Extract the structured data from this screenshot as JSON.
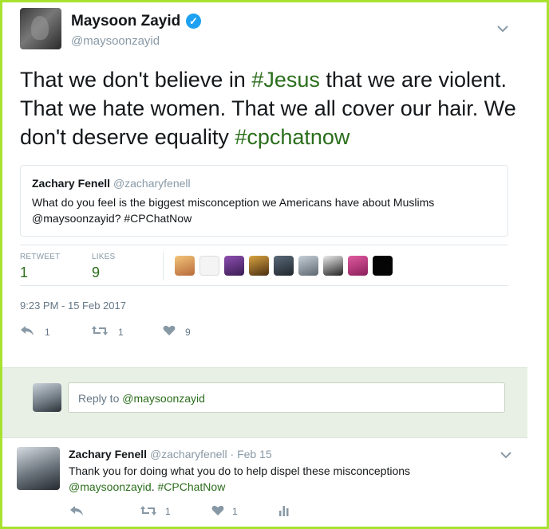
{
  "tweet": {
    "author_name": "Maysoon Zayid",
    "author_handle": "@maysoonzayid",
    "verified_glyph": "✓",
    "text_parts": [
      "That we don't believe in ",
      "#Jesus",
      " that we are violent. That we hate women.  That we all cover our hair. We don't deserve equality ",
      "#cpchatnow"
    ],
    "quoted": {
      "name": "Zachary Fenell",
      "handle": "@zacharyfenell",
      "text": "What do you feel is the biggest misconception we Americans have about Muslims @maysoonzayid? #CPChatNow"
    },
    "stats": {
      "retweets_label": "RETWEET",
      "retweets": "1",
      "likes_label": "LIKES",
      "likes": "9"
    },
    "timestamp": "9:23 PM - 15 Feb 2017",
    "actions": {
      "reply_count": "1",
      "retweet_count": "1",
      "like_count": "9"
    }
  },
  "reply_box": {
    "prefix": "Reply to ",
    "mention": "@maysoonzayid"
  },
  "reply_tweet": {
    "name": "Zachary Fenell",
    "handle": "@zacharyfenell",
    "separator": " · ",
    "date": "Feb 15",
    "text_line1": "Thank you for doing what you do to help dispel these misconceptions",
    "mention": "@maysoonzayid",
    "sep": ". ",
    "hashtag": "#CPChatNow",
    "retweet_count": "1",
    "like_count": "1"
  },
  "icons": {
    "chevron": "chevron-down-icon",
    "reply": "reply-icon",
    "retweet": "retweet-icon",
    "like": "heart-icon",
    "analytics": "analytics-icon"
  },
  "colors": {
    "accent": "#2b6e1c",
    "verified": "#1da1f2",
    "frame": "#a6e22e",
    "reply_bar": "#e8f0e6"
  }
}
